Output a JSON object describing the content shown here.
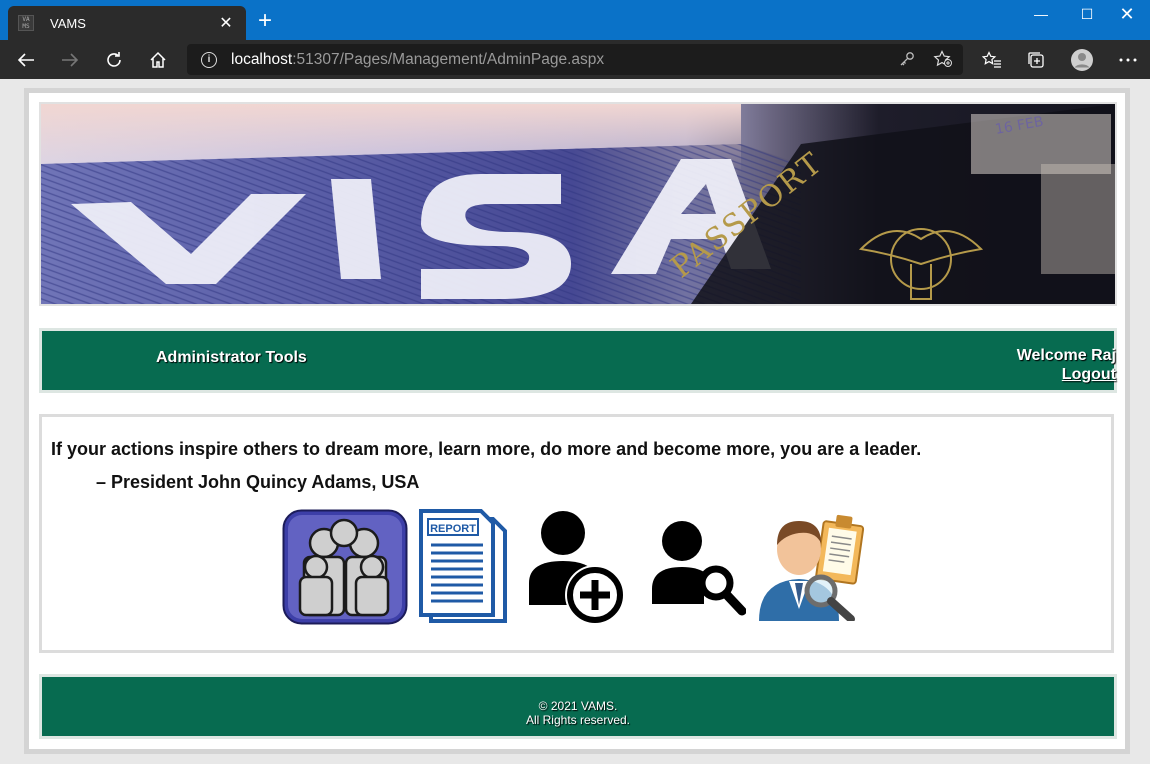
{
  "browser": {
    "tab_title": "VAMS",
    "favicon_text": "VA MS",
    "new_tab": "+",
    "url_host": "localhost",
    "url_path": ":51307/Pages/Management/AdminPage.aspx"
  },
  "header": {
    "banner_icon": "visa-passport-banner",
    "menu_title": "Administrator Tools",
    "welcome": "Welcome Raj",
    "logout": "Logout"
  },
  "content": {
    "quote": "If your actions inspire others to dream more, learn more, do more and become more, you are a leader.",
    "author": "– President John Quincy Adams, USA",
    "tools": [
      {
        "icon": "family-icon"
      },
      {
        "icon": "report-icon",
        "label": "REPORT"
      },
      {
        "icon": "add-user-icon"
      },
      {
        "icon": "search-user-icon"
      },
      {
        "icon": "user-record-search-icon"
      }
    ]
  },
  "footer": {
    "line1": "© 2021 VAMS.",
    "line2": "All Rights reserved."
  },
  "colors": {
    "brand_green": "#076b50",
    "browser_blue": "#0a72c8",
    "browser_dark": "#2b2b2b"
  }
}
